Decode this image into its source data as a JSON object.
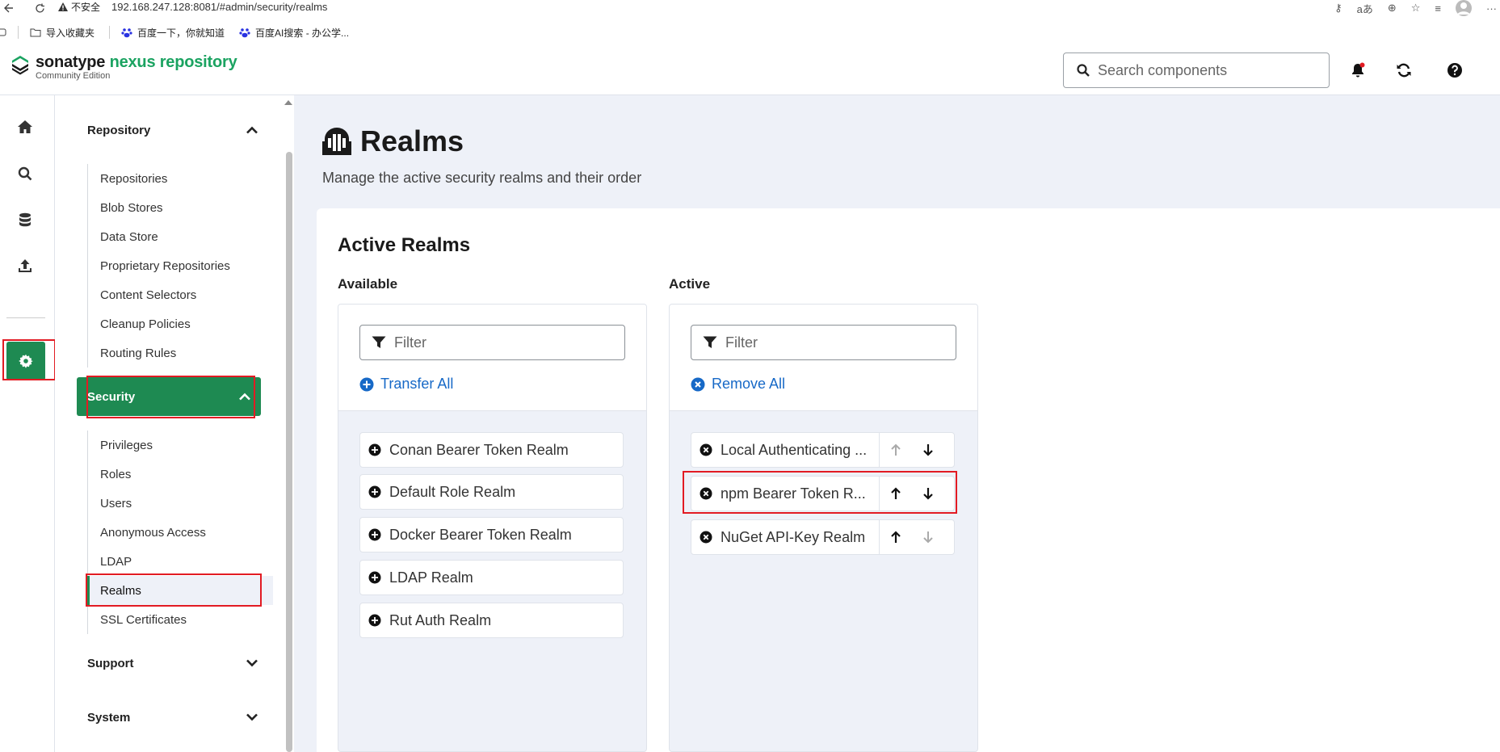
{
  "browser": {
    "insecure_label": "不安全",
    "url": "192.168.247.128:8081/#admin/security/realms",
    "bookmarks": [
      "导入收藏夹",
      "百度一下，你就知道",
      "百度AI搜索 - 办公学..."
    ]
  },
  "header": {
    "brand": "sonatype",
    "product": "nexus repository",
    "edition": "Community Edition",
    "search_placeholder": "Search components"
  },
  "sidebar": {
    "repository": {
      "label": "Repository",
      "items": [
        "Repositories",
        "Blob Stores",
        "Data Store",
        "Proprietary Repositories",
        "Content Selectors",
        "Cleanup Policies",
        "Routing Rules"
      ]
    },
    "security": {
      "label": "Security",
      "items": [
        "Privileges",
        "Roles",
        "Users",
        "Anonymous Access",
        "LDAP",
        "Realms",
        "SSL Certificates"
      ],
      "selected": "Realms"
    },
    "support": {
      "label": "Support"
    },
    "system": {
      "label": "System"
    }
  },
  "page": {
    "title": "Realms",
    "subtitle": "Manage the active security realms and their order",
    "section_title": "Active Realms",
    "available": {
      "label": "Available",
      "filter_placeholder": "Filter",
      "action": "Transfer All",
      "realms": [
        "Conan Bearer Token Realm",
        "Default Role Realm",
        "Docker Bearer Token Realm",
        "LDAP Realm",
        "Rut Auth Realm"
      ]
    },
    "active": {
      "label": "Active",
      "filter_placeholder": "Filter",
      "action": "Remove All",
      "realms": [
        "Local Authenticating ...",
        "npm Bearer Token R...",
        "NuGet API-Key Realm"
      ]
    }
  },
  "colors": {
    "accent": "#1e8a52",
    "brand_green": "#1ba361",
    "link": "#1769c7",
    "highlight": "#e21b23"
  }
}
